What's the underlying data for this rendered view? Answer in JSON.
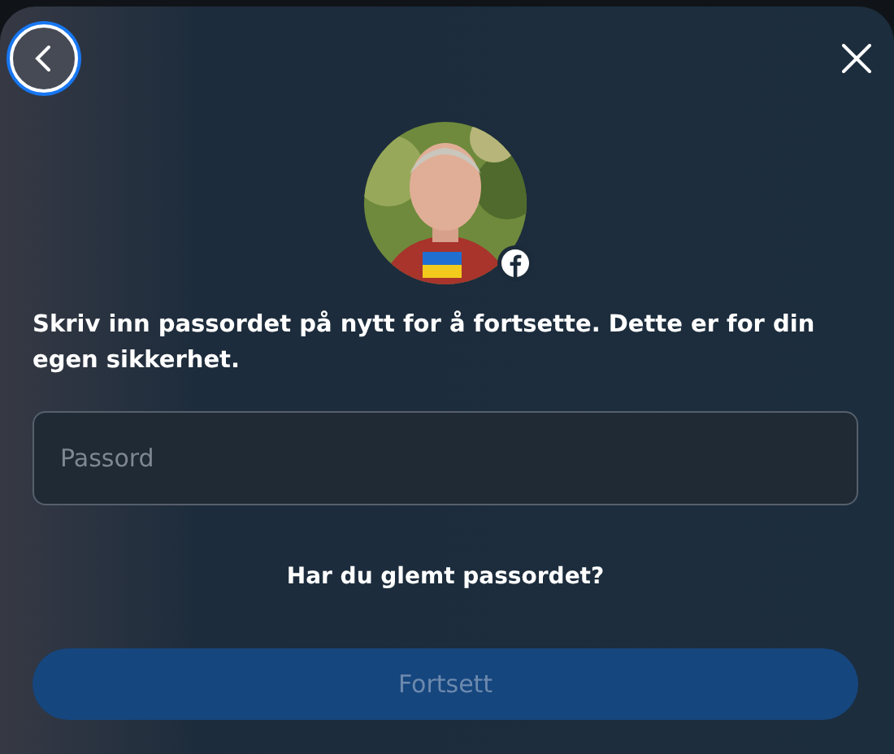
{
  "dialog": {
    "prompt": "Skriv inn passordet på nytt for å fortsette. Dette er for din egen sikkerhet.",
    "password": {
      "placeholder": "Passord"
    },
    "forgot_link": "Har du glemt passordet?",
    "continue_button": {
      "label": "Fortsett",
      "disabled": true
    }
  }
}
